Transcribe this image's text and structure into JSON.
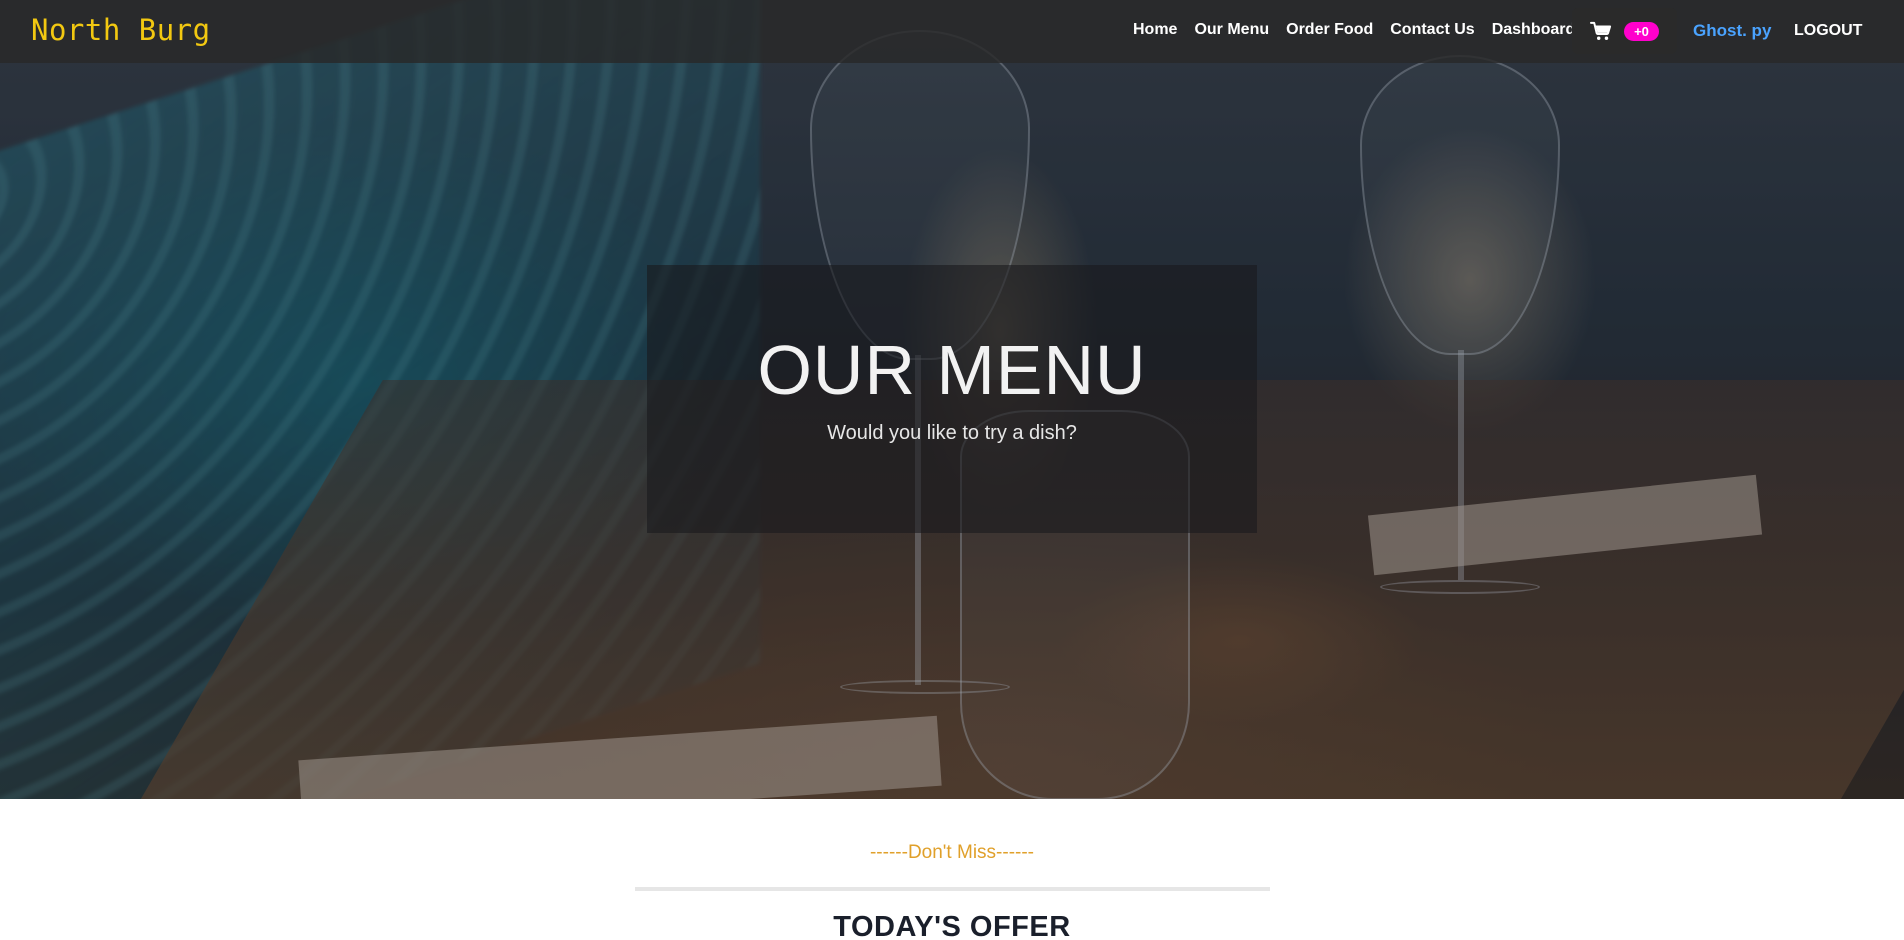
{
  "brand": "North Burg",
  "nav": {
    "links": [
      "Home",
      "Our Menu",
      "Order Food",
      "Contact Us",
      "Dashboard"
    ],
    "cart_badge": "+0",
    "user": "Ghost. py",
    "logout": "LOGOUT"
  },
  "icons": {
    "cart": "cart-icon"
  },
  "hero": {
    "title": "OUR MENU",
    "subtitle": "Would you like to try a dish?"
  },
  "offer": {
    "kicker": "------Don't Miss------",
    "title": "TODAY'S OFFER"
  },
  "colors": {
    "brand": "#f2c811",
    "cart_badge": "#ff00cc",
    "user_link": "#4aa3ff",
    "kicker": "#e0a02a"
  }
}
